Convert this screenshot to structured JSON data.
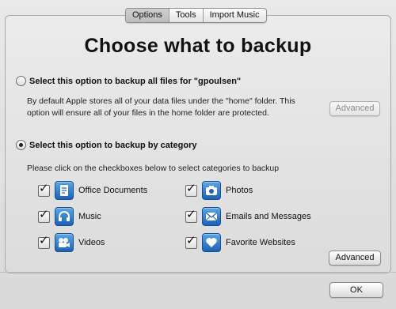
{
  "tabs": [
    "Options",
    "Tools",
    "Import Music"
  ],
  "active_tab": "Options",
  "title": "Choose what to backup",
  "option_all": {
    "label": "Select this option to backup all files for \"gpoulsen\"",
    "description_line1": "By default Apple stores all of your data files under the \"home\" folder.  This",
    "description_line2": "option will ensure all of your files in the home folder are protected.",
    "advanced_label": "Advanced",
    "selected": false
  },
  "option_category": {
    "label": "Select this option to backup by category",
    "instructions": "Please click on the checkboxes below to select categories to backup",
    "selected": true,
    "advanced_label": "Advanced"
  },
  "categories": [
    {
      "label": "Office Documents",
      "icon": "document-icon",
      "checked": true
    },
    {
      "label": "Photos",
      "icon": "camera-icon",
      "checked": true
    },
    {
      "label": "Music",
      "icon": "headphones-icon",
      "checked": true
    },
    {
      "label": "Emails and Messages",
      "icon": "envelope-icon",
      "checked": true
    },
    {
      "label": "Videos",
      "icon": "film-camera-icon",
      "checked": true
    },
    {
      "label": "Favorite Websites",
      "icon": "heart-icon",
      "checked": true
    }
  ],
  "ok_label": "OK",
  "icon_color": "#1d62b5"
}
